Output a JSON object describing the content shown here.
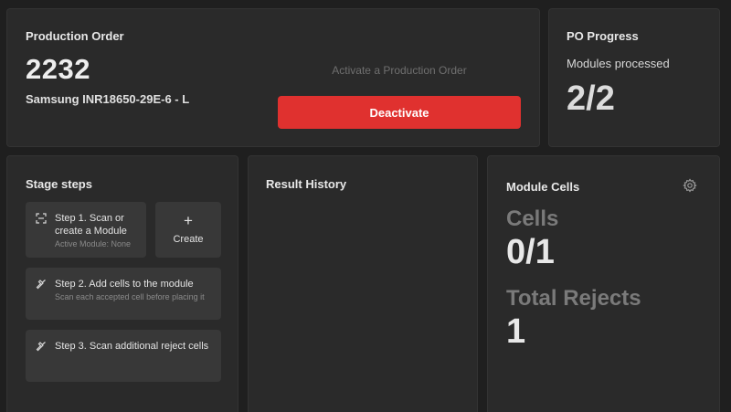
{
  "production_order": {
    "title": "Production Order",
    "number": "2232",
    "product": "Samsung INR18650-29E-6 - L",
    "activate_hint": "Activate a Production Order",
    "deactivate_label": "Deactivate"
  },
  "po_progress": {
    "title": "PO Progress",
    "subtitle": "Modules processed",
    "value": "2/2"
  },
  "stage_steps": {
    "title": "Stage steps",
    "step1": {
      "label": "Step 1. Scan or create a Module",
      "description": "Active Module: None",
      "icon": "scan-icon"
    },
    "create": {
      "label": "Create",
      "icon": "plus-icon"
    },
    "step2": {
      "label": "Step 2. Add cells to the module",
      "description": "Scan each accepted cell before placing it",
      "icon": "hammer-icon"
    },
    "step3": {
      "label": "Step 3. Scan additional reject cells",
      "icon": "hammer-icon"
    }
  },
  "result_history": {
    "title": "Result History"
  },
  "module_cells": {
    "title": "Module Cells",
    "cells_label": "Cells",
    "cells_value": "0/1",
    "rejects_label": "Total Rejects",
    "rejects_value": "1",
    "settings_icon": "gear-icon"
  },
  "colors": {
    "accent_red": "#e0312f",
    "card_bg": "#2a2a2a",
    "page_bg": "#1f1f1f"
  }
}
